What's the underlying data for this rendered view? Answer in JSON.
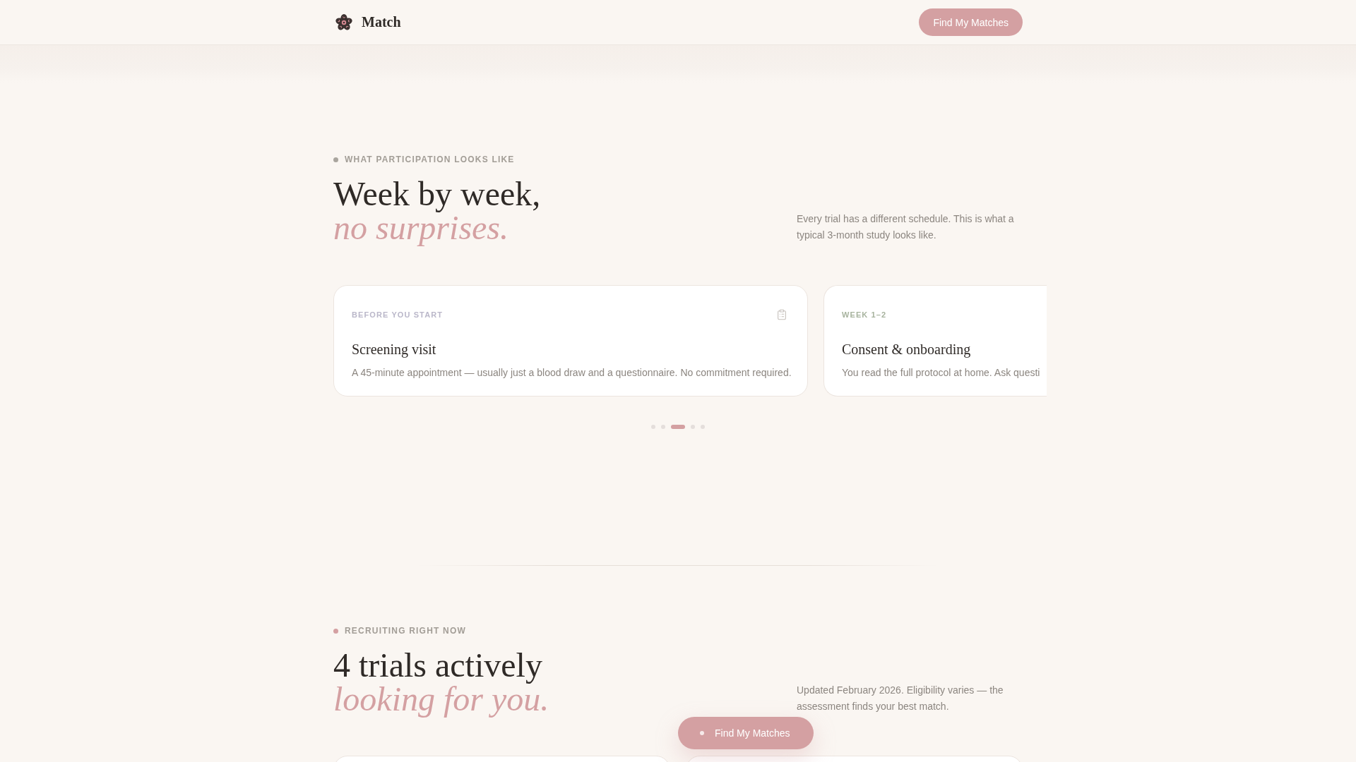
{
  "header": {
    "brand": "Match",
    "cta": "Find My Matches"
  },
  "schedule": {
    "eyebrow": {
      "text": "WHAT PARTICIPATION LOOKS LIKE",
      "color": "#a9a59e"
    },
    "title": "Week by week,",
    "title_accent": "no surprises.",
    "intro": "Every trial has a different schedule. This is what a typical 3-month study looks like.",
    "steps": [
      {
        "label": "BEFORE YOU START",
        "color": "#bab7c9",
        "icon_shown": true,
        "title": "Screening visit",
        "text": "A 45-minute appointment — usually just a blood draw and a questionnaire. No commitment required."
      },
      {
        "label": "WEEK 1–2",
        "color": "#a7b39e",
        "icon_shown": false,
        "title": "Consent & onboarding",
        "text": "You read the full protocol at home. Ask questi"
      }
    ],
    "dots": [
      {
        "selected": false
      },
      {
        "selected": false
      },
      {
        "selected": true
      },
      {
        "selected": false
      },
      {
        "selected": false
      }
    ]
  },
  "recruiting": {
    "eyebrow": {
      "text": "RECRUITING RIGHT NOW",
      "color": "#d4a0a2"
    },
    "title": "4 trials actively",
    "title_accent": "looking for you.",
    "intro": "Updated February 2026. Eligibility varies — the assessment finds your best match."
  },
  "floating_button": {
    "label": "Find My Matches"
  }
}
